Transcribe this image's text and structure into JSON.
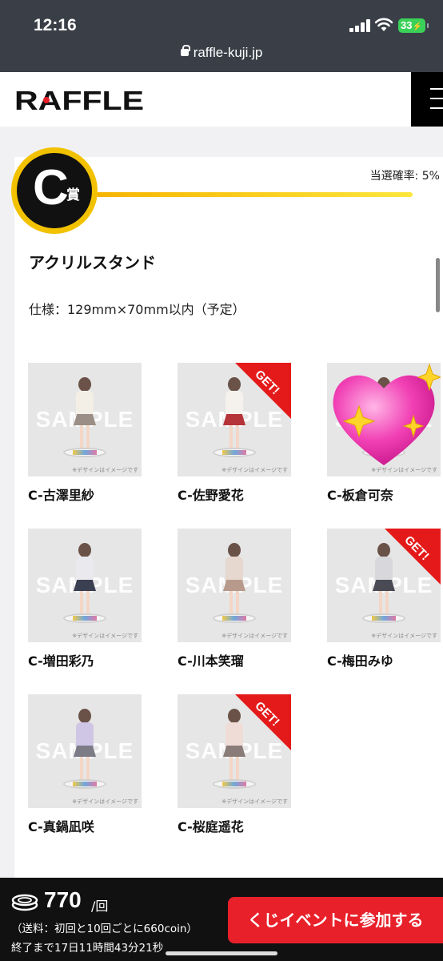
{
  "status_bar": {
    "time": "12:16",
    "battery": "33",
    "url": "raffle-kuji.jp"
  },
  "header": {
    "logo": "RAFFLE",
    "accent_color": "#e8202a"
  },
  "prize": {
    "letter": "C",
    "suffix": "賞",
    "win_rate": "当選確率: 5%",
    "title": "アクリルスタンド",
    "spec": "仕様：129mm×70mm以内（予定）"
  },
  "items": [
    {
      "name": "C-古澤里紗",
      "got": false,
      "hearted": false,
      "outfit": "#f3efe6",
      "skirt": "#9a8e86"
    },
    {
      "name": "C-佐野愛花",
      "got": true,
      "hearted": false,
      "outfit": "#f5f2ee",
      "skirt": "#b5343a"
    },
    {
      "name": "C-板倉可奈",
      "got": false,
      "hearted": true,
      "outfit": "#f2ede8",
      "skirt": "#8e8a88"
    },
    {
      "name": "C-増田彩乃",
      "got": false,
      "hearted": false,
      "outfit": "#e9e9ee",
      "skirt": "#3b3f52"
    },
    {
      "name": "C-川本笑瑠",
      "got": false,
      "hearted": false,
      "outfit": "#e6d7cf",
      "skirt": "#b89a8c"
    },
    {
      "name": "C-梅田みゆ",
      "got": true,
      "hearted": false,
      "outfit": "#d8d8dc",
      "skirt": "#4a4a55"
    },
    {
      "name": "C-真鍋凪咲",
      "got": false,
      "hearted": false,
      "outfit": "#cfc6e6",
      "skirt": "#7c7b86"
    },
    {
      "name": "C-桜庭遥花",
      "got": true,
      "hearted": false,
      "outfit": "#f0dcd6",
      "skirt": "#8a7c78"
    }
  ],
  "thumb_text": {
    "sample": "SAMPLE",
    "disclaimer": "※デザインはイメージです",
    "get": "GET!"
  },
  "footer": {
    "price": "770",
    "per": "/回",
    "shipping": "（送料：初回と10回ごとに660coin）",
    "countdown": "終了まで17日11時間43分21秒",
    "join_button": "くじイベントに参加する"
  }
}
